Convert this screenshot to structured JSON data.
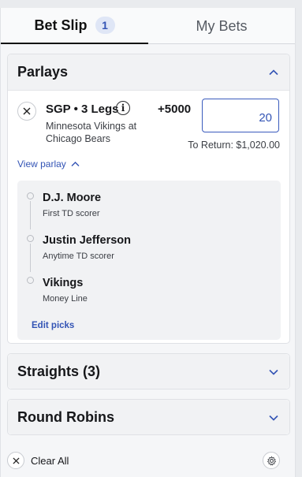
{
  "tabs": {
    "bet_slip": {
      "label": "Bet Slip",
      "count": "1"
    },
    "my_bets": {
      "label": "My Bets"
    }
  },
  "parlays": {
    "title": "Parlays",
    "bet": {
      "title": "SGP • 3 Legs",
      "matchup_line1": "Minnesota Vikings at",
      "matchup_line2": "Chicago Bears",
      "odds": "+5000",
      "wager": "20",
      "to_return": "To Return: $1,020.00",
      "view_parlay": "View parlay"
    },
    "legs": [
      {
        "name": "D.J. Moore",
        "market": "First TD scorer"
      },
      {
        "name": "Justin Jefferson",
        "market": "Anytime TD scorer"
      },
      {
        "name": "Vikings",
        "market": "Money Line"
      }
    ],
    "edit_picks": "Edit picks"
  },
  "straights": {
    "title": "Straights (3)"
  },
  "round_robins": {
    "title": "Round Robins"
  },
  "footer": {
    "clear_all": "Clear All"
  },
  "colors": {
    "accent": "#3354b5",
    "panel": "#f5f6f8",
    "header": "#f1f2f4"
  },
  "icons": [
    "close-icon",
    "info-icon",
    "chevron-up-icon",
    "chevron-down-icon",
    "gear-icon"
  ]
}
